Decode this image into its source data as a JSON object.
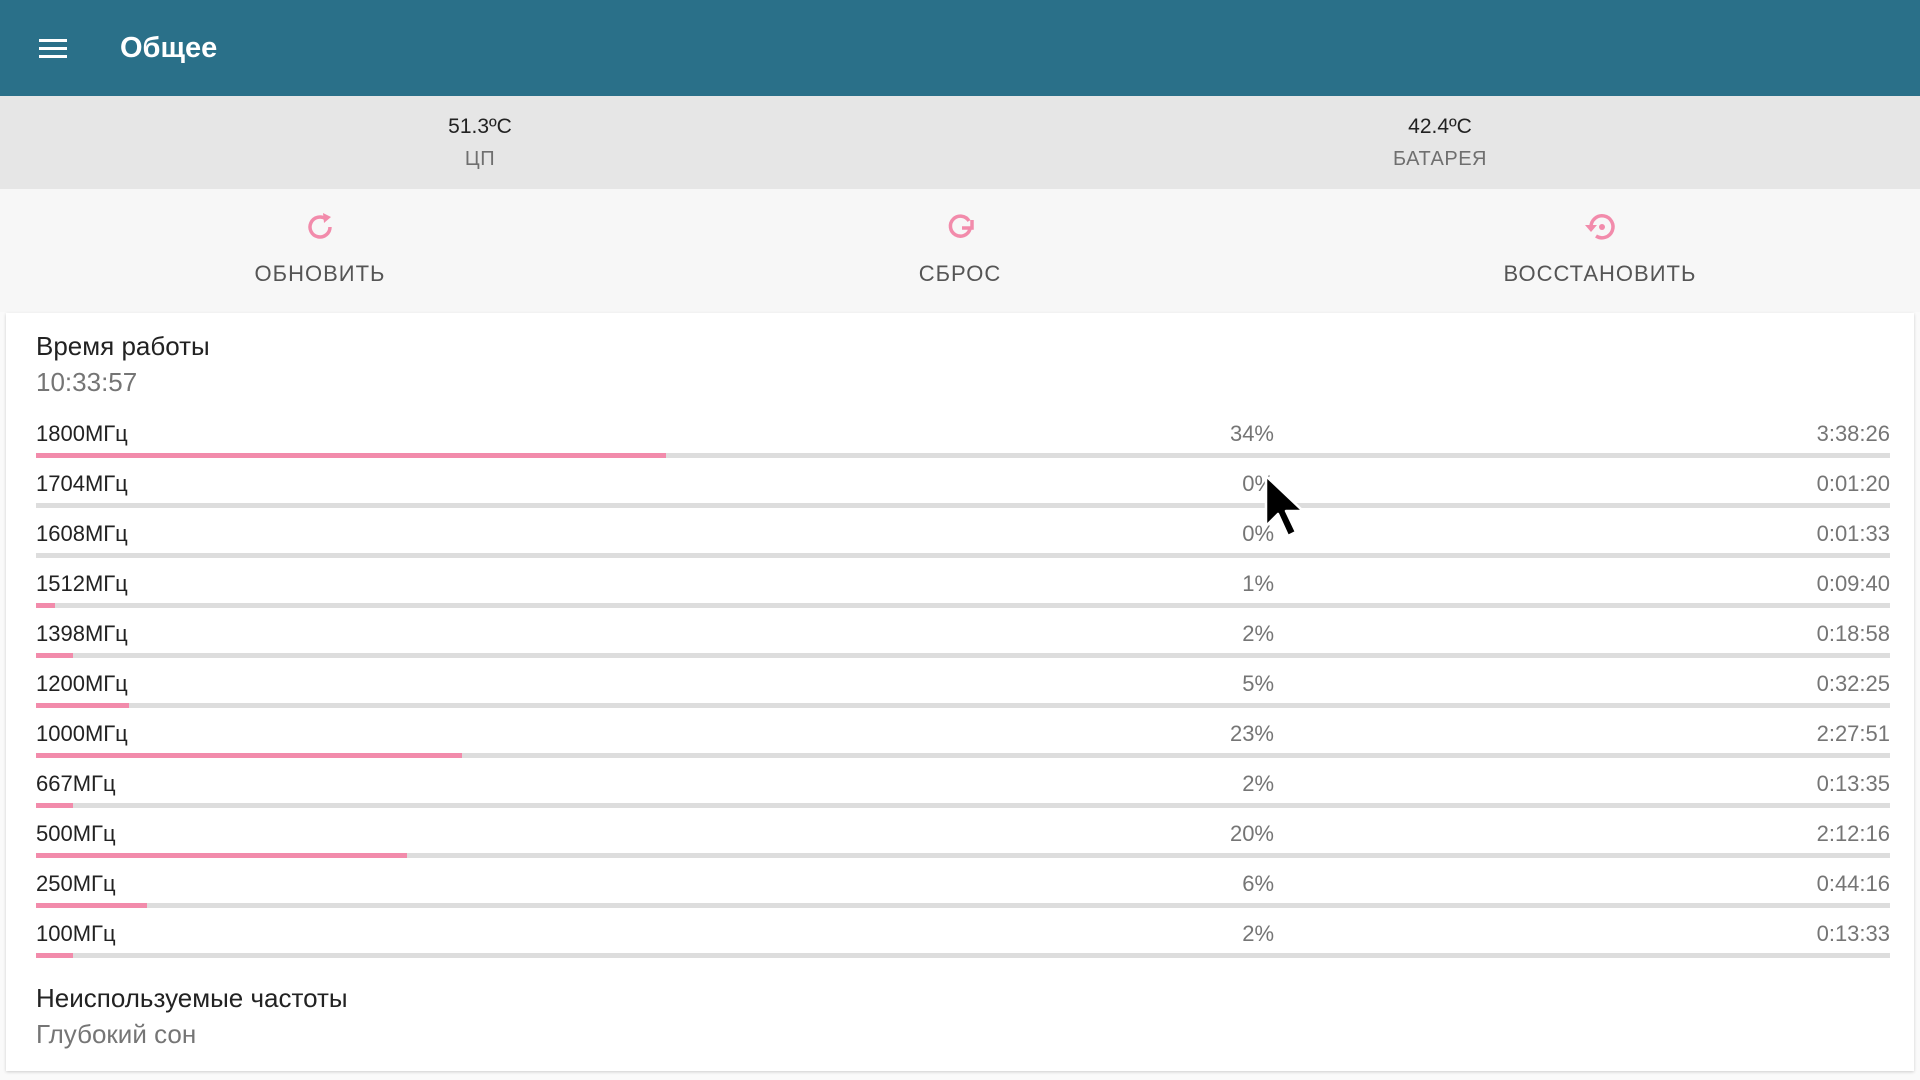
{
  "appbar": {
    "title": "Общее",
    "menu_icon": "menu-icon"
  },
  "temps": [
    {
      "value": "51.3ºC",
      "label": "ЦП"
    },
    {
      "value": "42.4ºC",
      "label": "БАТАРЕЯ"
    }
  ],
  "actions": [
    {
      "label": "ОБНОВИТЬ",
      "icon": "refresh-icon"
    },
    {
      "label": "СБРОС",
      "icon": "reset-icon"
    },
    {
      "label": "ВОССТАНОВИТЬ",
      "icon": "restore-icon"
    }
  ],
  "colors": {
    "appbar": "#2a7089",
    "accent": "#f28bab",
    "track": "#dddddd"
  },
  "uptime": {
    "title": "Время работы",
    "value": "10:33:57"
  },
  "frequencies": [
    {
      "freq": "1800МГц",
      "percent": "34%",
      "fraction": 0.34,
      "time": "3:38:26"
    },
    {
      "freq": "1704МГц",
      "percent": "0%",
      "fraction": 0.0,
      "time": "0:01:20"
    },
    {
      "freq": "1608МГц",
      "percent": "0%",
      "fraction": 0.0,
      "time": "0:01:33"
    },
    {
      "freq": "1512МГц",
      "percent": "1%",
      "fraction": 0.01,
      "time": "0:09:40"
    },
    {
      "freq": "1398МГц",
      "percent": "2%",
      "fraction": 0.02,
      "time": "0:18:58"
    },
    {
      "freq": "1200МГц",
      "percent": "5%",
      "fraction": 0.05,
      "time": "0:32:25"
    },
    {
      "freq": "1000МГц",
      "percent": "23%",
      "fraction": 0.23,
      "time": "2:27:51"
    },
    {
      "freq": "667МГц",
      "percent": "2%",
      "fraction": 0.02,
      "time": "0:13:35"
    },
    {
      "freq": "500МГц",
      "percent": "20%",
      "fraction": 0.2,
      "time": "2:12:16"
    },
    {
      "freq": "250МГц",
      "percent": "6%",
      "fraction": 0.06,
      "time": "0:44:16"
    },
    {
      "freq": "100МГц",
      "percent": "2%",
      "fraction": 0.02,
      "time": "0:13:33"
    }
  ],
  "unused": {
    "title": "Неиспользуемые частоты",
    "value": "Глубокий сон"
  }
}
